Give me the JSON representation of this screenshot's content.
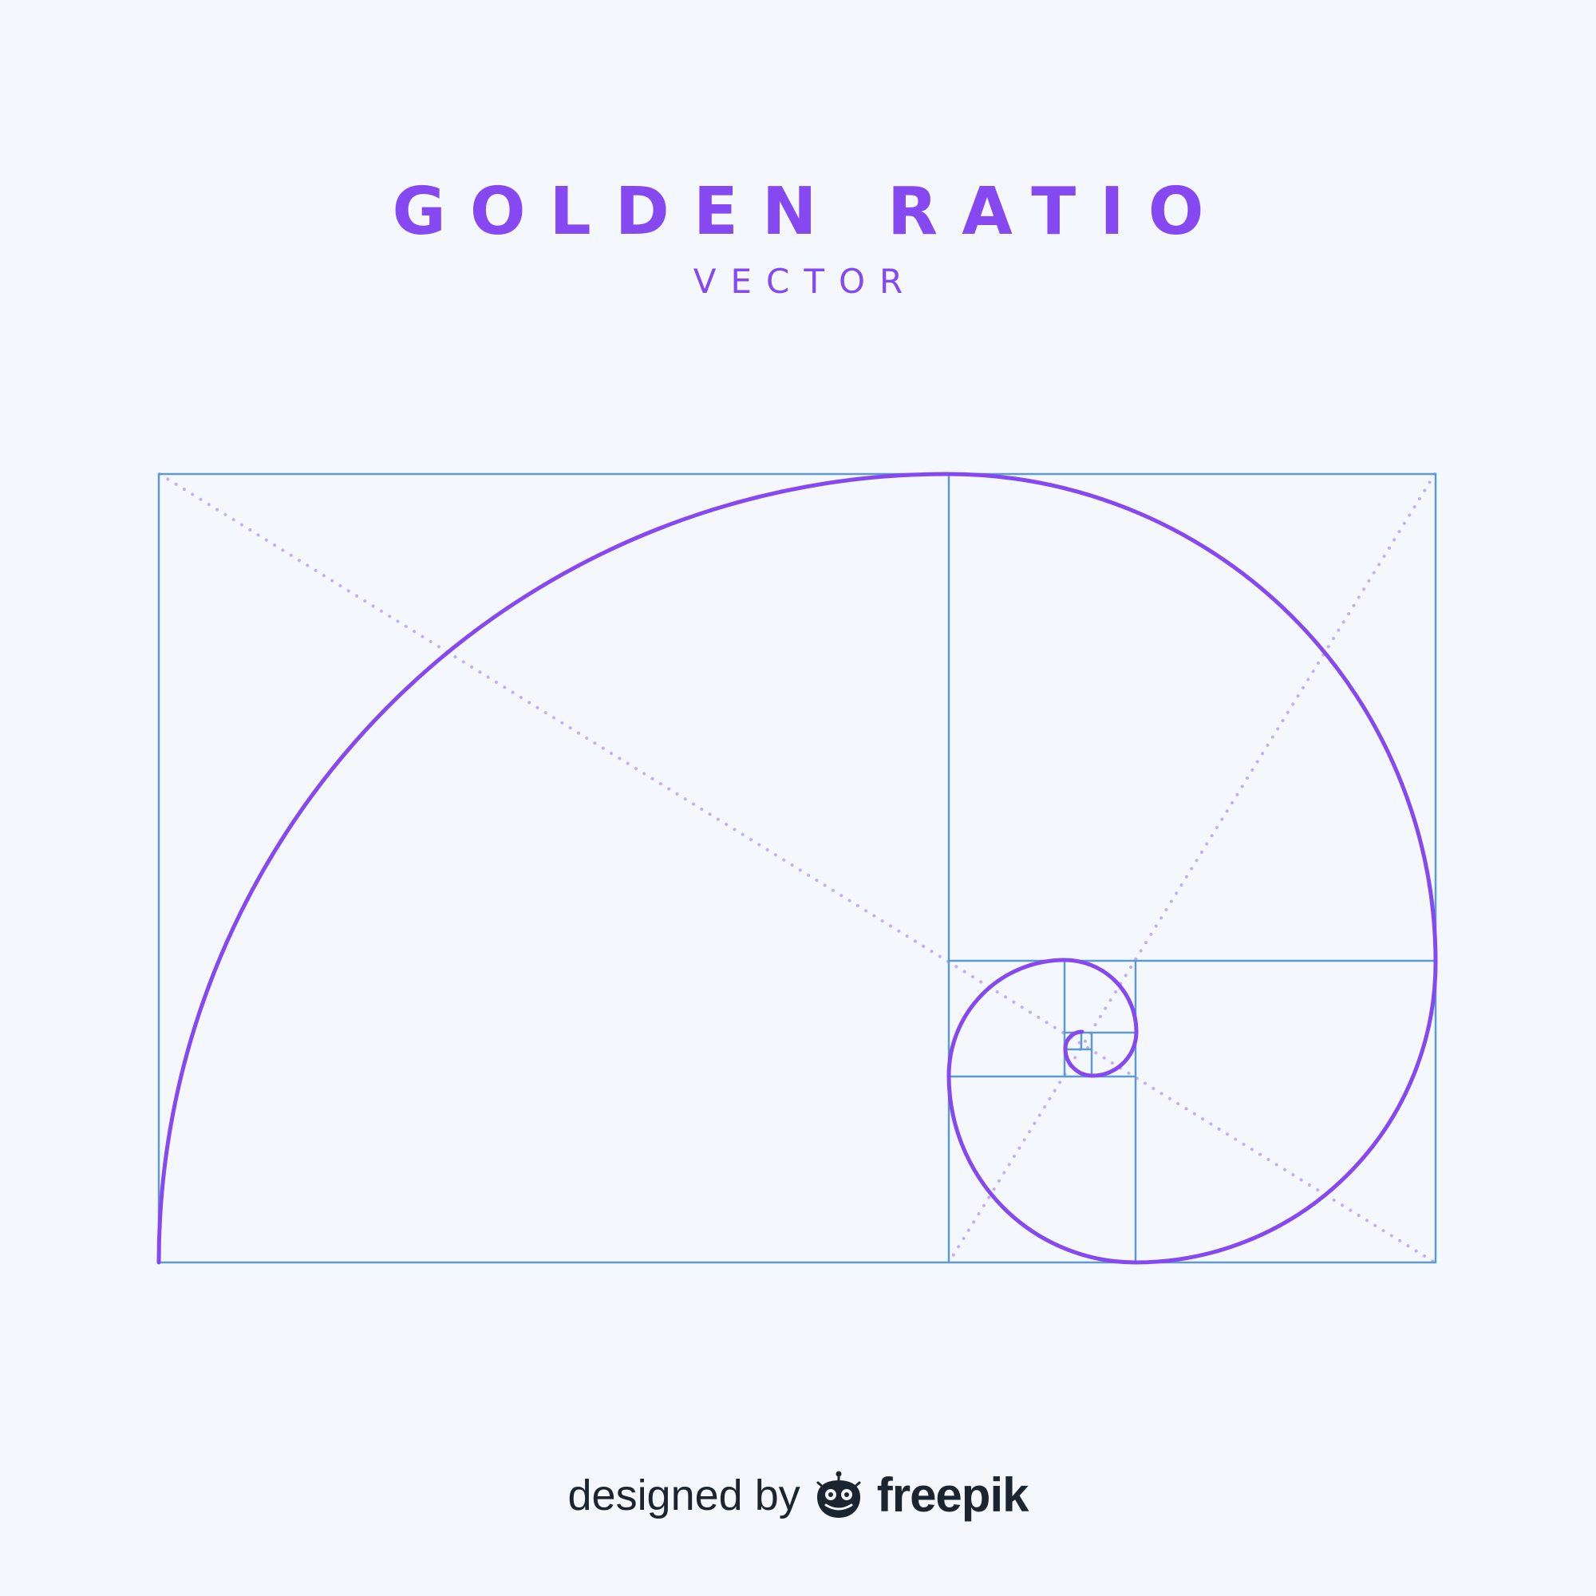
{
  "header": {
    "title": "GOLDEN RATIO",
    "subtitle": "VECTOR"
  },
  "footer": {
    "credit_prefix": "designed by",
    "brand": "freepik"
  },
  "icons": {
    "brand_logo": "freepik-mascot-icon"
  },
  "colors": {
    "background": "#f4f7fc",
    "accent": "#8548f1",
    "grid": "#5b9bd0",
    "diagonal": "#c4aef5",
    "text_dark": "#1b2530"
  }
}
